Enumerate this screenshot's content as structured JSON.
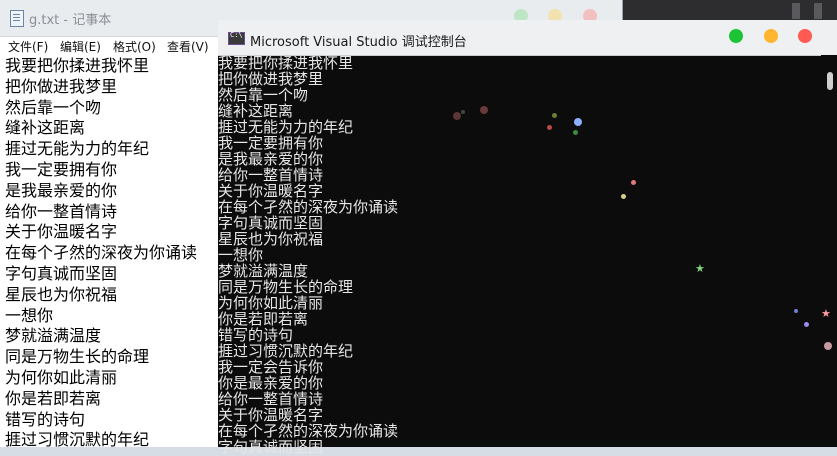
{
  "colors": {
    "light_green": "#5ec56a",
    "light_yellow": "#e8c15a",
    "light_red": "#ea6b6b",
    "console_bg": "#0c0c0c",
    "console_text": "#e6e6e6"
  },
  "notepad": {
    "title": "g.txt - 记事本",
    "icon": "notepad-doc-icon",
    "menu": [
      "文件(F)",
      "编辑(E)",
      "格式(O)",
      "查看(V)"
    ],
    "lines": [
      "我要把你揉进我怀里",
      "把你做进我梦里",
      "然后靠一个吻",
      "缝补这距离",
      "捱过无能为力的年纪",
      "我一定要拥有你",
      "是我最亲爱的你",
      "给你一整首情诗",
      "关于你温暖名字",
      "在每个孑然的深夜为你诵读",
      "字句真诚而坚固",
      "星辰也为你祝福",
      "一想你",
      "梦就溢满温度",
      "同是万物生长的命理",
      "为何你如此清丽",
      "你是若即若离",
      "错写的诗句",
      "捱过习惯沉默的年纪"
    ]
  },
  "console": {
    "title": "Microsoft Visual Studio 调试控制台",
    "icon": "console-app-icon",
    "lines": [
      "我要把你揉进我怀里",
      "把你做进我梦里",
      "然后靠一个吻",
      "缝补这距离",
      "捱过无能为力的年纪",
      "我一定要拥有你",
      "是我最亲爱的你",
      "给你一整首情诗",
      "关于你温暖名字",
      "在每个孑然的深夜为你诵读",
      "字句真诚而坚固",
      "星辰也为你祝福",
      "一想你",
      "梦就溢满温度",
      "同是万物生长的命理",
      "为何你如此清丽",
      "你是若即若离",
      "错写的诗句",
      "捱过习惯沉默的年纪",
      "我一定会告诉你",
      "你是最亲爱的你",
      "给你一整首情诗",
      "关于你温暖名字",
      "在每个孑然的深夜为你诵读",
      "字句真诚而坚固"
    ],
    "sparkles": [
      {
        "color": "#5a3636"
      },
      {
        "color": "#3c4a3c"
      },
      {
        "color": "#6a3a3a"
      },
      {
        "color": "#6b7f3a"
      },
      {
        "color": "#b84a4a"
      },
      {
        "color": "#8ab0ff"
      },
      {
        "color": "#3f8a3f"
      },
      {
        "color": "#e07b7b"
      },
      {
        "color": "#d8d08a"
      },
      {
        "color": "#7fd67f"
      },
      {
        "color": "#6b7fd6"
      },
      {
        "color": "#a08af0"
      },
      {
        "color": "#ff9aa6"
      },
      {
        "color": "#c59aa0"
      }
    ]
  }
}
